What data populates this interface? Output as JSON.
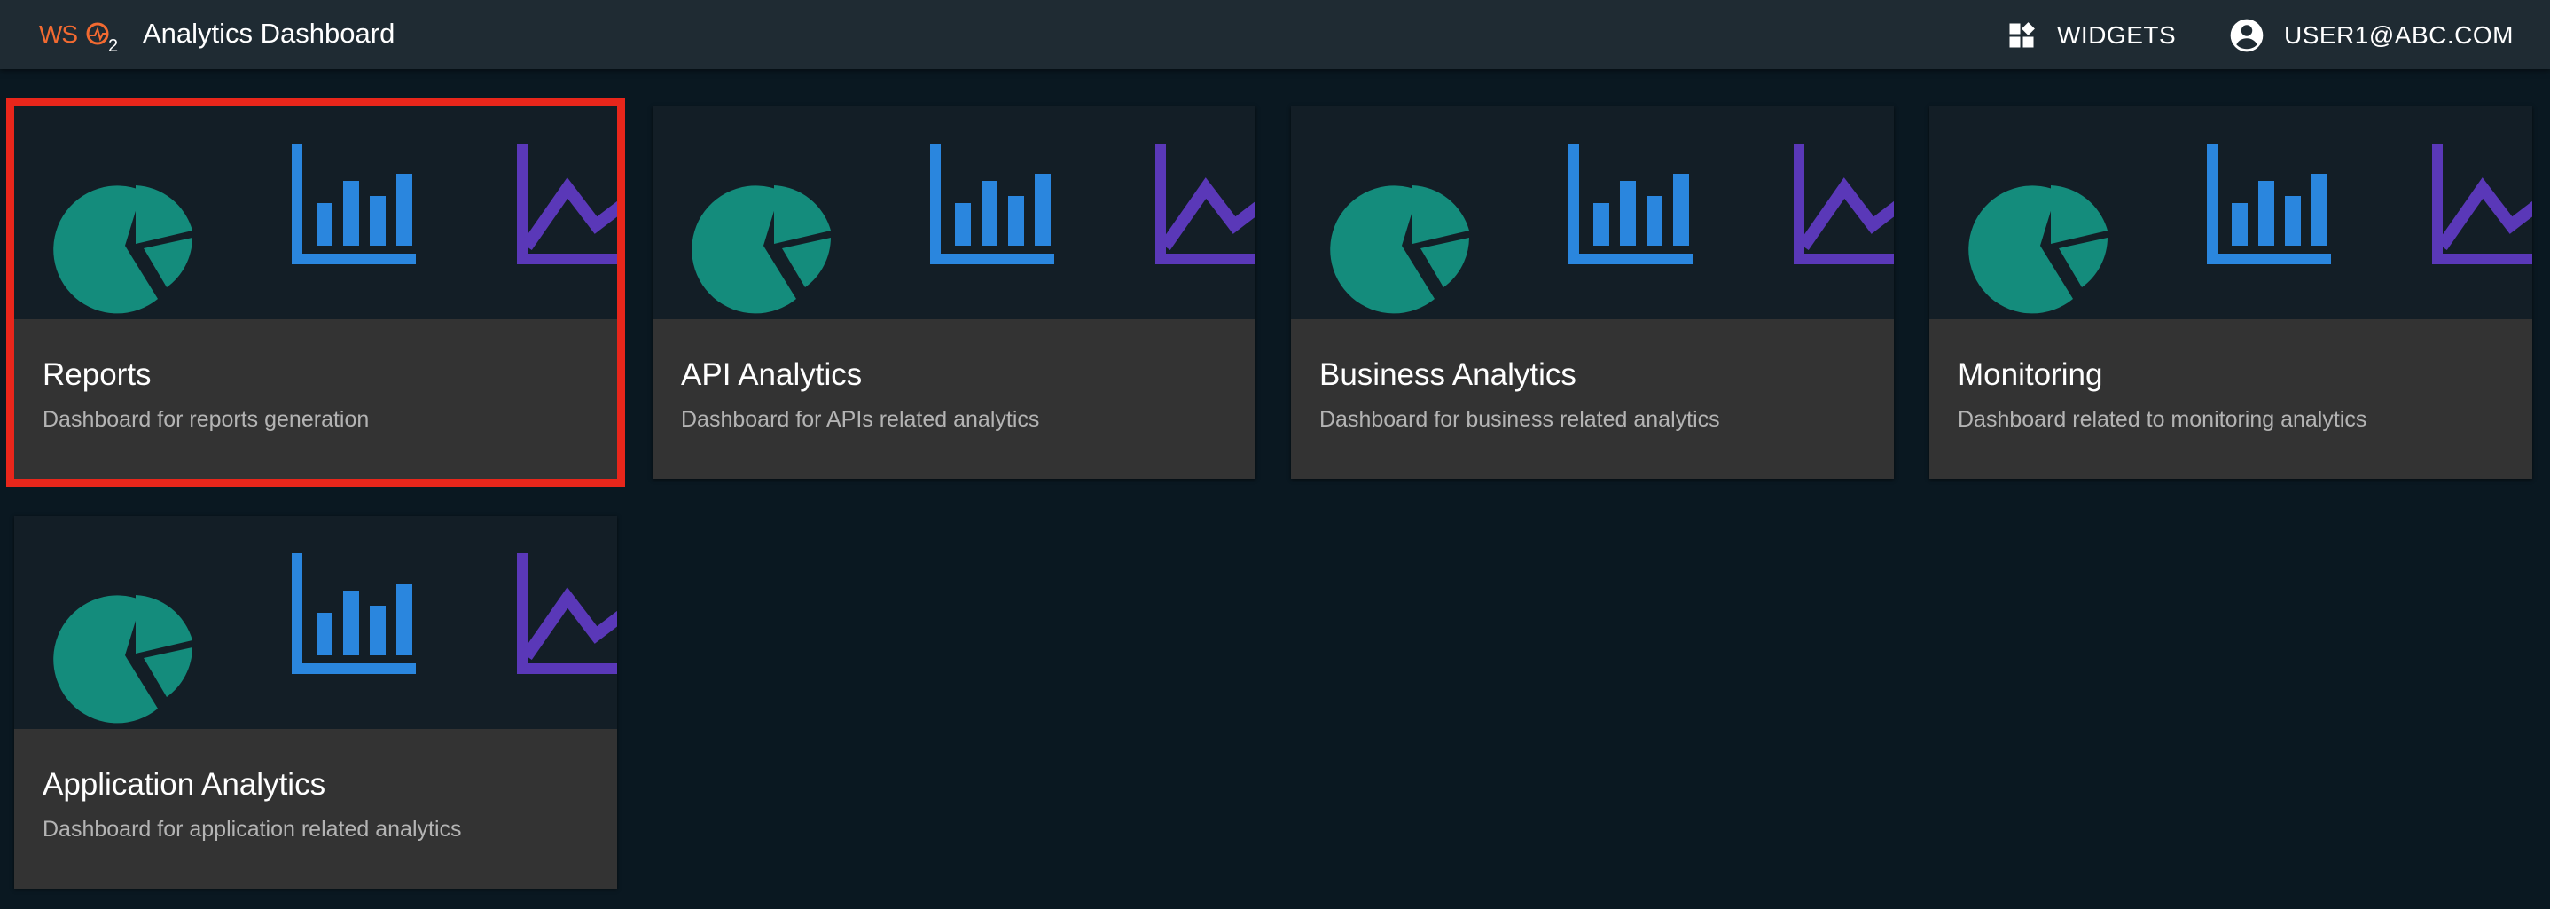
{
  "header": {
    "logo_text": "WSO2",
    "title": "Analytics Dashboard",
    "widgets_label": "WIDGETS",
    "widgets_icon": "widgets-icon",
    "user_label": "USER1@ABC.COM",
    "user_icon": "account-circle-icon"
  },
  "colors": {
    "header_bg": "#1f2b33",
    "page_bg": "#0a1821",
    "card_bg": "#333333",
    "thumb_bg": "#131e26",
    "pie": "#148c7c",
    "bar": "#2a86de",
    "line": "#5a38b8",
    "selection": "#e8261b",
    "logo": "#f26a31"
  },
  "cards": [
    {
      "title": "Reports",
      "description": "Dashboard for reports generation",
      "selected": true
    },
    {
      "title": "API Analytics",
      "description": "Dashboard for APIs related analytics",
      "selected": false
    },
    {
      "title": "Business Analytics",
      "description": "Dashboard for business related analytics",
      "selected": false
    },
    {
      "title": "Monitoring",
      "description": "Dashboard related to monitoring analytics",
      "selected": false
    },
    {
      "title": "Application Analytics",
      "description": "Dashboard for application related analytics",
      "selected": false
    }
  ],
  "thumbnail_icons": [
    "pie-chart-icon",
    "bar-chart-icon",
    "line-chart-icon"
  ]
}
